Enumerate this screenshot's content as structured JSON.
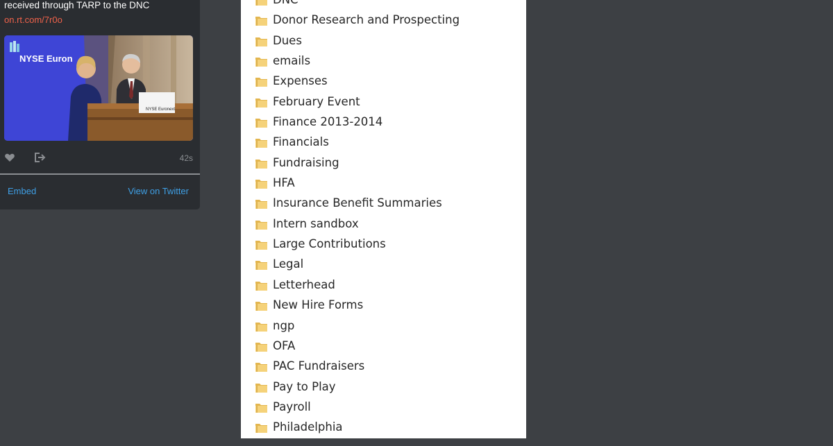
{
  "tweet": {
    "text": "received through TARP to the DNC",
    "link": "on.rt.com/7r0o",
    "image_banner": "NYSE Euron",
    "podium_sign": "NYSE Euronext",
    "timestamp": "42s",
    "like_icon": "heart-icon",
    "share_icon": "share-icon",
    "embed_label": "Embed",
    "view_label": "View on Twitter",
    "link_color": "#f0624a",
    "action_color": "#3fa0e6"
  },
  "folders": [
    "DNC",
    "Donor Research and Prospecting",
    "Dues",
    "emails",
    "Expenses",
    "February Event",
    "Finance 2013-2014",
    "Financials",
    "Fundraising",
    "HFA",
    "Insurance Benefit Summaries",
    "Intern sandbox",
    "Large Contributions",
    "Legal",
    "Letterhead",
    "New Hire Forms",
    "ngp",
    "OFA",
    "PAC Fundraisers",
    "Pay to Play",
    "Payroll",
    "Philadelphia"
  ]
}
